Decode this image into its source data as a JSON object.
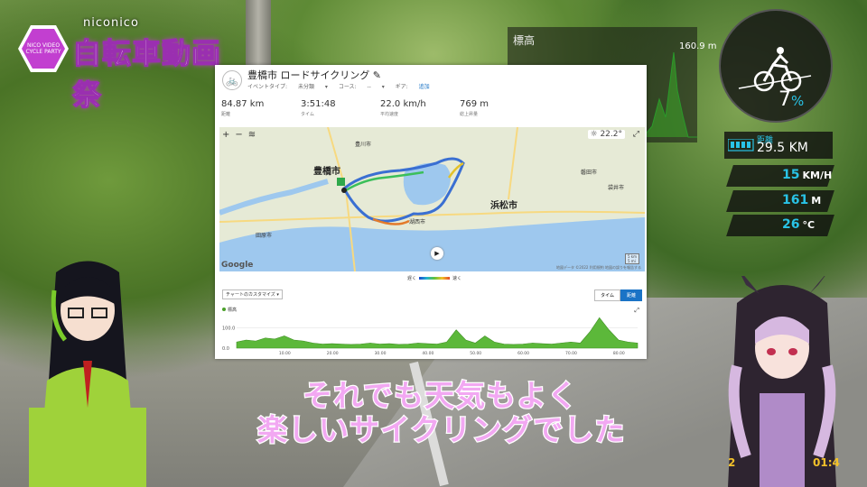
{
  "logo": {
    "badge_text": "NICO VIDEO CYCLE PARTY",
    "sub": "niconico",
    "title": "自転車動画祭"
  },
  "overlay": {
    "elevation_label": "標高",
    "elevation_max": "160.9 m",
    "grade_value": "7",
    "grade_unit": "%",
    "distance_label": "距離",
    "distance_value": "29.5 KM",
    "speed_value": "15",
    "speed_unit": "KM/H",
    "altitude_value": "161",
    "altitude_unit": "M",
    "temp_value": "26",
    "temp_unit": "°C",
    "clock_date": "2",
    "clock_time": "01:4"
  },
  "activity": {
    "title": "豊橋市 ロードサイクリング",
    "meta_event_label": "イベントタイプ:",
    "meta_event_value": "未分類",
    "meta_course_label": "コース:",
    "meta_course_value": "--",
    "meta_gear_label": "ギア:",
    "meta_gear_value": "追加",
    "stats": [
      {
        "value": "84.87 km",
        "label": "距離"
      },
      {
        "value": "3:51:48",
        "label": "タイム"
      },
      {
        "value": "22.0 km/h",
        "label": "平均速度"
      },
      {
        "value": "769 m",
        "label": "総上昇量"
      }
    ]
  },
  "map": {
    "zoom_in": "+",
    "zoom_out": "−",
    "layers": "≋",
    "temperature": "22.2°",
    "expand": "⤢",
    "google": "Google",
    "footer": "地図データ ©2022  利用規約  地図の誤りを報告する",
    "scale_km": "5 km",
    "scale_mi": "5 mi",
    "cities": {
      "toyohashi": "豊橋市",
      "hamamatsu": "浜松市"
    },
    "small_labels": [
      "豊川市",
      "湖西市",
      "田原市",
      "磐田市",
      "袋井市"
    ]
  },
  "legend": {
    "slow": "遅く",
    "fast": "速く"
  },
  "chart_controls": {
    "customize": "チャートのカスタマイズ ▾",
    "time": "タイム",
    "distance": "距離",
    "series_label": "標高",
    "expand": "⤢"
  },
  "chart_data": {
    "type": "area",
    "series": [
      {
        "name": "標高"
      }
    ],
    "x_ticks": [
      "10.00",
      "20.00",
      "30.00",
      "40.00",
      "50.00",
      "60.00",
      "70.00",
      "80.00"
    ],
    "x_values": [
      0,
      2,
      4,
      6,
      8,
      10,
      12,
      14,
      16,
      18,
      20,
      22,
      24,
      26,
      28,
      30,
      32,
      34,
      36,
      38,
      40,
      42,
      44,
      46,
      48,
      50,
      52,
      54,
      56,
      58,
      60,
      62,
      64,
      66,
      68,
      70,
      72,
      74,
      76,
      78,
      80,
      82,
      84
    ],
    "values": [
      30,
      40,
      35,
      50,
      45,
      60,
      40,
      35,
      25,
      20,
      22,
      20,
      18,
      20,
      25,
      20,
      22,
      18,
      20,
      25,
      22,
      20,
      30,
      90,
      40,
      25,
      60,
      30,
      20,
      18,
      20,
      25,
      22,
      20,
      25,
      30,
      25,
      80,
      150,
      90,
      40,
      30,
      25
    ],
    "y_ticks": [
      "100.0",
      "0.0"
    ],
    "ylim": [
      0,
      160
    ]
  },
  "subtitles": {
    "line1": "それでも天気もよく",
    "line2": "楽しいサイクリングでした"
  }
}
